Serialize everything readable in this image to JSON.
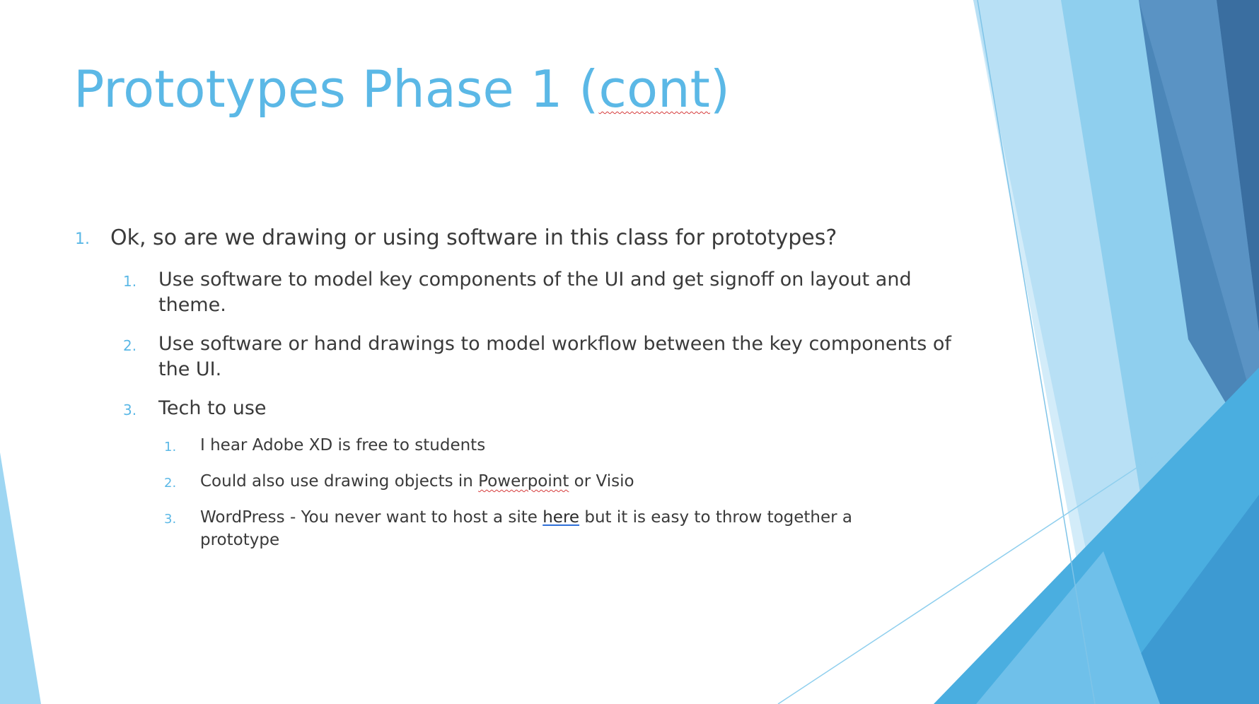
{
  "slide": {
    "title_main": "Prototypes Phase 1 (",
    "title_marked": "cont",
    "title_end": ")"
  },
  "content": {
    "q1": {
      "number": "1.",
      "text": "Ok, so are we drawing or using software in this class for prototypes?"
    },
    "sub": [
      {
        "number": "1.",
        "text": "Use software to model key components of the UI and get signoff on layout and theme."
      },
      {
        "number": "2.",
        "text": "Use software or hand drawings to model workflow between the key components of the UI."
      },
      {
        "number": "3.",
        "text": "Tech to use"
      }
    ],
    "tech": [
      {
        "number": "1.",
        "text": "I hear Adobe XD is free to students"
      },
      {
        "number": "2.",
        "before": "Could also use drawing objects in ",
        "marked": "Powerpoint",
        "after": " or Visio"
      },
      {
        "number": "3.",
        "before": "WordPress - You never want to host a site ",
        "link": "here",
        "after": " but it is easy to throw together a prototype"
      }
    ]
  },
  "colors": {
    "accent": "#5bb8e6",
    "body_text": "#3a3a3a",
    "decor_light": "#8fd0f0",
    "decor_mid": "#4aaee0",
    "decor_dark": "#3a6ea0"
  }
}
